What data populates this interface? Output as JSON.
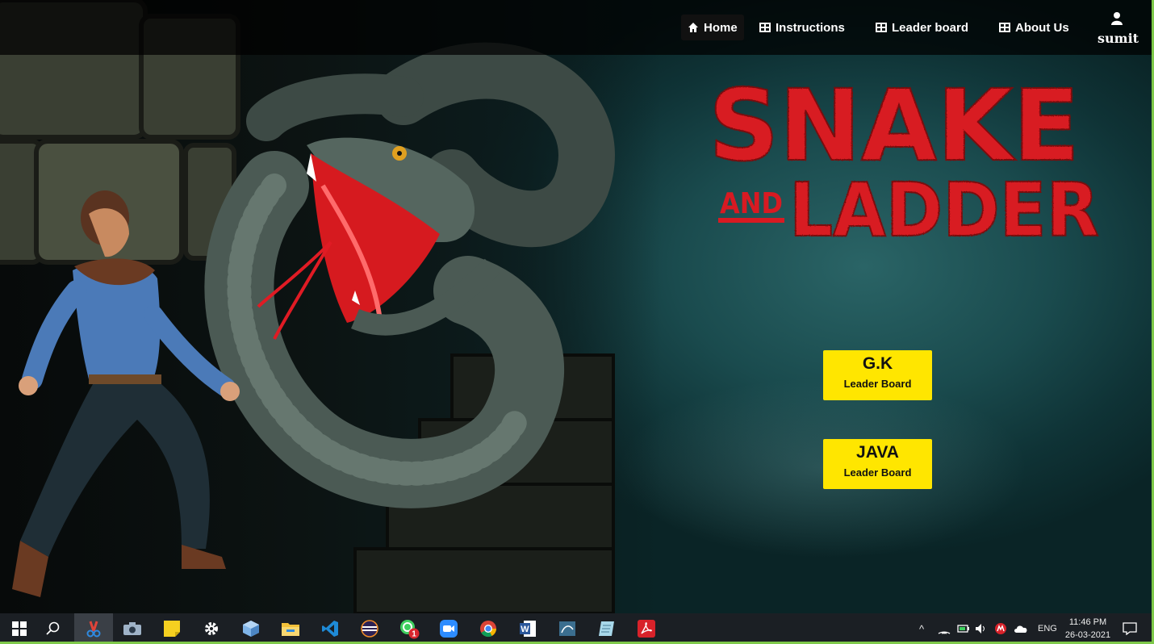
{
  "nav": {
    "home": "Home",
    "instructions": "Instructions",
    "leaderboard": "Leader board",
    "about": "About Us",
    "user": "sumit"
  },
  "logo": {
    "line1": "SNAKE",
    "and": "AND",
    "line2": "LADDER"
  },
  "buttons": [
    {
      "title": "G.K",
      "subtitle": "Leader Board"
    },
    {
      "title": "JAVA",
      "subtitle": "Leader Board"
    }
  ],
  "taskbar": {
    "icons": [
      "windows-start-icon",
      "search-icon",
      "snipping-tool-icon",
      "camera-icon",
      "sticky-notes-icon",
      "settings-icon",
      "3d-box-icon",
      "file-explorer-icon",
      "vscode-icon",
      "eclipse-icon",
      "whatsapp-icon",
      "zoom-icon",
      "chrome-icon",
      "word-icon",
      "mysql-icon",
      "notepad-icon",
      "acrobat-icon"
    ],
    "whatsapp_badge": "1",
    "language": "ENG",
    "time": "11:46 PM",
    "date": "26-03-2021"
  },
  "colors": {
    "button": "#ffe600",
    "logo_red": "#e01b24",
    "teal": "#1a4b4e"
  }
}
